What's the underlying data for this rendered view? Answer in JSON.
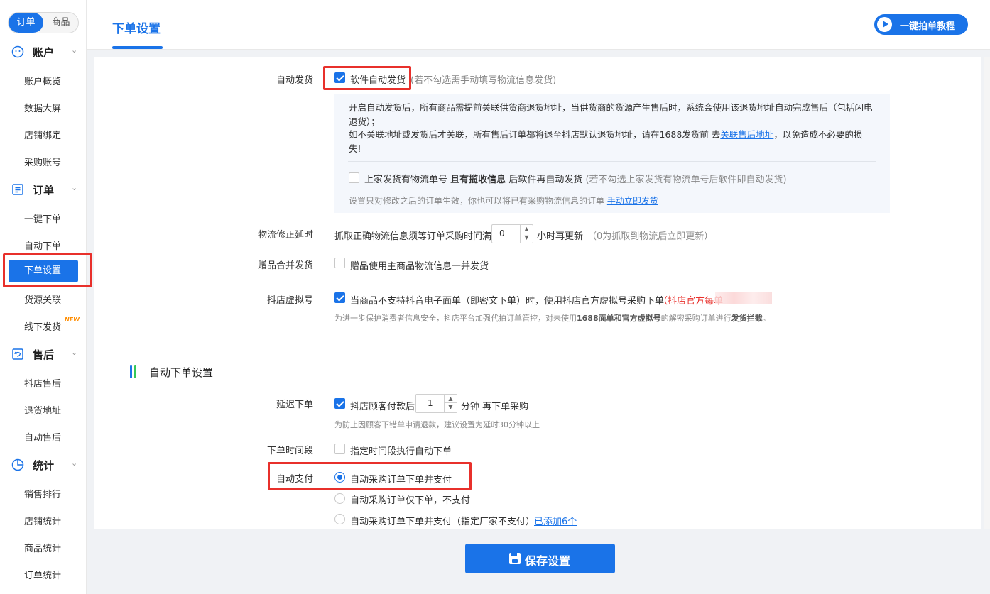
{
  "sidebar": {
    "seg": [
      "订单",
      "商品"
    ],
    "groups": [
      {
        "label": "账户",
        "items": [
          "账户概览",
          "数据大屏",
          "店铺绑定",
          "采购账号"
        ]
      },
      {
        "label": "订单",
        "items": [
          "一键下单",
          "自动下单",
          "下单设置",
          "货源关联",
          "线下发货"
        ]
      },
      {
        "label": "售后",
        "items": [
          "抖店售后",
          "退货地址",
          "自动售后"
        ]
      },
      {
        "label": "统计",
        "items": [
          "销售排行",
          "店铺统计",
          "商品统计",
          "订单统计"
        ]
      }
    ],
    "new_badge": "NEW",
    "active": "下单设置"
  },
  "header": {
    "title": "下单设置",
    "tutorial_btn": "一键拍单教程"
  },
  "form": {
    "auto_ship": {
      "label": "自动发货",
      "checkbox": "软件自动发货",
      "hint": "(若不勾选需手动填写物流信息发货)",
      "checked": true
    },
    "info": {
      "p1": "开启自动发货后，所有商品需提前关联供货商退货地址，当供货商的货源产生售后时，系统会使用该退货地址自动完成售后（包括闪电退货）；",
      "p2a": "如不关联地址或发货后才关联，所有售后订单都将退至抖店默认退货地址，请在1688发货前 去",
      "p2_link": "关联售后地址",
      "p2b": "，以免造成不必要的损失!",
      "opt_a": "上家发货有物流单号",
      "opt_b": "且有揽收信息",
      "opt_c": "后软件再自动发货",
      "opt_hint": "(若不勾选上家发货有物流单号后软件即自动发货)",
      "note": "设置只对修改之后的订单生效，你也可以将已有采购物流信息的订单",
      "note_link": "手动立即发货"
    },
    "logistics_delay": {
      "label": "物流修正延时",
      "pre": "抓取正确物流信息须等订单采购时间满",
      "value": "0",
      "post": "小时再更新",
      "hint": "（0为抓取到物流后立即更新）"
    },
    "gift_merge": {
      "label": "赠品合并发货",
      "checkbox": "赠品使用主商品物流信息一并发货",
      "checked": false
    },
    "virtual_no": {
      "label": "抖店虚拟号",
      "checkbox": "当商品不支持抖音电子面单（即密文下单）时，使用抖店官方虚拟号采购下单",
      "red": "（抖店官方每单",
      "note_a": "为进一步保护消费者信息安全，抖店平台加强代拍订单管控，对未使用",
      "note_b": "1688面单和官方虚拟号",
      "note_c": "的解密采购订单进行",
      "note_d": "发货拦截",
      "note_e": "。",
      "checked": true
    },
    "section_title": "自动下单设置",
    "delay_order": {
      "label": "延迟下单",
      "pre": "抖店顾客付款后",
      "value": "1",
      "post": "分钟 再下单采购",
      "hint": "为防止因顾客下错单申请退款，建议设置为延时30分钟以上",
      "checked": true
    },
    "time_range": {
      "label": "下单时间段",
      "checkbox": "指定时间段执行自动下单",
      "checked": false
    },
    "auto_pay": {
      "label": "自动支付",
      "options": [
        "自动采购订单下单并支付",
        "自动采购订单仅下单，不支付",
        "自动采购订单下单并支付（指定厂家不支付）"
      ],
      "selected": 0,
      "added_link": "已添加6个"
    }
  },
  "footer": {
    "save": "保存设置"
  },
  "colors": {
    "primary": "#1a73e8",
    "highlight": "#e8302b",
    "red_text": "#e8302b"
  }
}
